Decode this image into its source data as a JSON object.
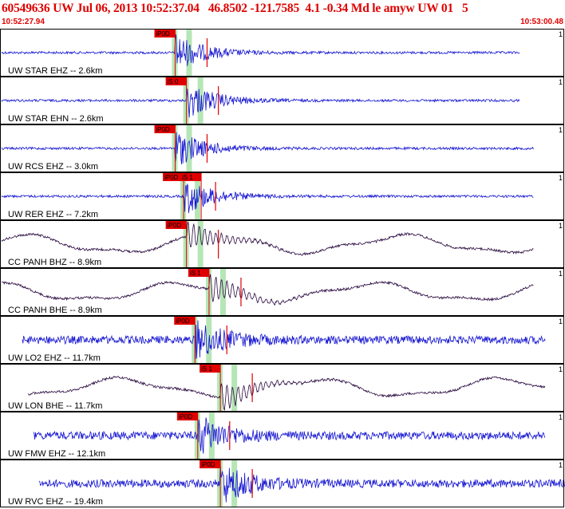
{
  "header": {
    "title": "60549636 UW Jul 06, 2013 10:52:37.04   46.8502 -121.7585  4.1 -0.34 Md le amyw UW 01   5",
    "time_start": "10:52:27.94",
    "time_end": "10:53:00.48"
  },
  "colors": {
    "title": "#e00000",
    "trace_blue": "#1414d2",
    "trace_dark": "#2a0a40",
    "pick": "#e00000",
    "window": "#b6e6b6",
    "frame": "#000000"
  },
  "chart_data": {
    "type": "line",
    "title": "60549636 UW Jul 06, 2013 10:52:37.04   46.8502 -121.7585  4.1 -0.34 Md le amyw UW 01   5",
    "x_range": [
      "10:52:27.94",
      "10:53:00.48"
    ],
    "series": [
      {
        "name": "UW STAR EHZ -- 2.6km",
        "scale": "1",
        "picks": [
          "iP0D"
        ],
        "color": "#1414d2",
        "onset": 0.31,
        "end": 0.92
      },
      {
        "name": "UW STAR EHN -- 2.6km",
        "scale": "1",
        "picks": [
          "iS 0"
        ],
        "color": "#1414d2",
        "onset": 0.33,
        "end": 0.92
      },
      {
        "name": "UW RCS EHZ -- 3.0km",
        "scale": "1",
        "picks": [
          "iP0D"
        ],
        "color": "#1414d2",
        "onset": 0.31,
        "end": 0.945
      },
      {
        "name": "UW RER EHZ -- 7.2km",
        "scale": "1",
        "picks": [
          "iP0D",
          "iS 1"
        ],
        "color": "#1414d2",
        "onset": 0.325,
        "end": 0.945
      },
      {
        "name": "CC PANH BHZ -- 8.9km",
        "scale": "1",
        "picks": [
          "iP0D"
        ],
        "color": "#2a0a40",
        "onset": 0.33,
        "end": 0.945
      },
      {
        "name": "CC PANH BHE -- 8.9km",
        "scale": "1",
        "picks": [
          "iS 1"
        ],
        "color": "#2a0a40",
        "onset": 0.37,
        "end": 0.945
      },
      {
        "name": "UW LO2 EHZ -- 11.7km",
        "scale": "1",
        "picks": [
          "iP0D"
        ],
        "color": "#1414d2",
        "onset": 0.345,
        "end": 0.965
      },
      {
        "name": "UW LON BHE -- 11.7km",
        "scale": "1",
        "picks": [
          "iS 1"
        ],
        "color": "#2a0a40",
        "onset": 0.39,
        "end": 0.965
      },
      {
        "name": "UW FMW EHZ -- 12.1km",
        "scale": "1",
        "picks": [
          "iP0D"
        ],
        "color": "#1414d2",
        "onset": 0.35,
        "end": 0.965
      },
      {
        "name": "UW RVC EHZ -- 19.4km",
        "scale": "1",
        "picks": [
          "iP0D"
        ],
        "color": "#1414d2",
        "onset": 0.39,
        "end": 1.0
      }
    ]
  }
}
